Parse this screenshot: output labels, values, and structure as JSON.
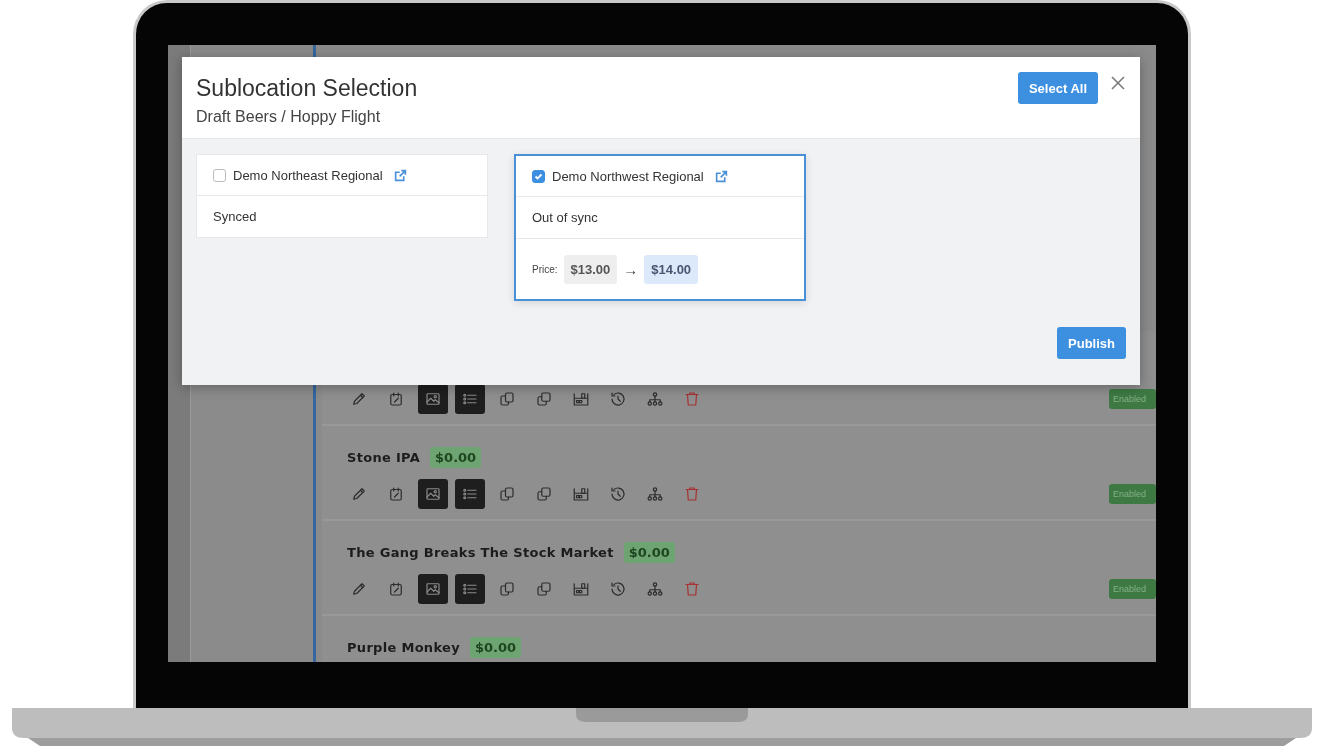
{
  "modal": {
    "title": "Sublocation Selection",
    "subtitle": "Draft Beers / Hoppy Flight",
    "select_all": "Select All",
    "publish": "Publish",
    "sublocations": [
      {
        "name": "Demo Northeast Regional",
        "checked": false,
        "status": "Synced"
      },
      {
        "name": "Demo Northwest Regional",
        "checked": true,
        "status": "Out of sync",
        "price": {
          "label": "Price:",
          "from": "$13.00",
          "arrow": "→",
          "to": "$14.00"
        }
      }
    ]
  },
  "background": {
    "rows": [
      {
        "actions": [
          {
            "kind": "pencil",
            "active": false
          },
          {
            "kind": "calendar",
            "active": false
          },
          {
            "kind": "image",
            "active": true
          },
          {
            "kind": "list",
            "active": true
          },
          {
            "kind": "copy",
            "active": false
          },
          {
            "kind": "duplicate",
            "active": false
          },
          {
            "kind": "shelf",
            "active": false
          },
          {
            "kind": "history",
            "active": false
          },
          {
            "kind": "hierarchy",
            "active": false
          },
          {
            "kind": "trash",
            "active": false
          }
        ],
        "status": "Enabled"
      },
      {
        "title": "Stone IPA",
        "price": "$0.00",
        "actions": [
          {
            "kind": "pencil",
            "active": false
          },
          {
            "kind": "calendar",
            "active": false
          },
          {
            "kind": "image",
            "active": true
          },
          {
            "kind": "list",
            "active": true
          },
          {
            "kind": "copy",
            "active": false
          },
          {
            "kind": "duplicate",
            "active": false
          },
          {
            "kind": "shelf",
            "active": false
          },
          {
            "kind": "history",
            "active": false
          },
          {
            "kind": "hierarchy",
            "active": false
          },
          {
            "kind": "trash",
            "active": false
          }
        ],
        "status": "Enabled"
      },
      {
        "title": "The Gang Breaks The Stock Market",
        "price": "$0.00",
        "actions": [
          {
            "kind": "pencil",
            "active": false
          },
          {
            "kind": "calendar",
            "active": false
          },
          {
            "kind": "image",
            "active": true
          },
          {
            "kind": "list",
            "active": true
          },
          {
            "kind": "copy",
            "active": false
          },
          {
            "kind": "duplicate",
            "active": false
          },
          {
            "kind": "shelf",
            "active": false
          },
          {
            "kind": "history",
            "active": false
          },
          {
            "kind": "hierarchy",
            "active": false
          },
          {
            "kind": "trash",
            "active": false
          }
        ],
        "status": "Enabled"
      },
      {
        "title": "Purple Monkey",
        "price": "$0.00"
      }
    ]
  }
}
